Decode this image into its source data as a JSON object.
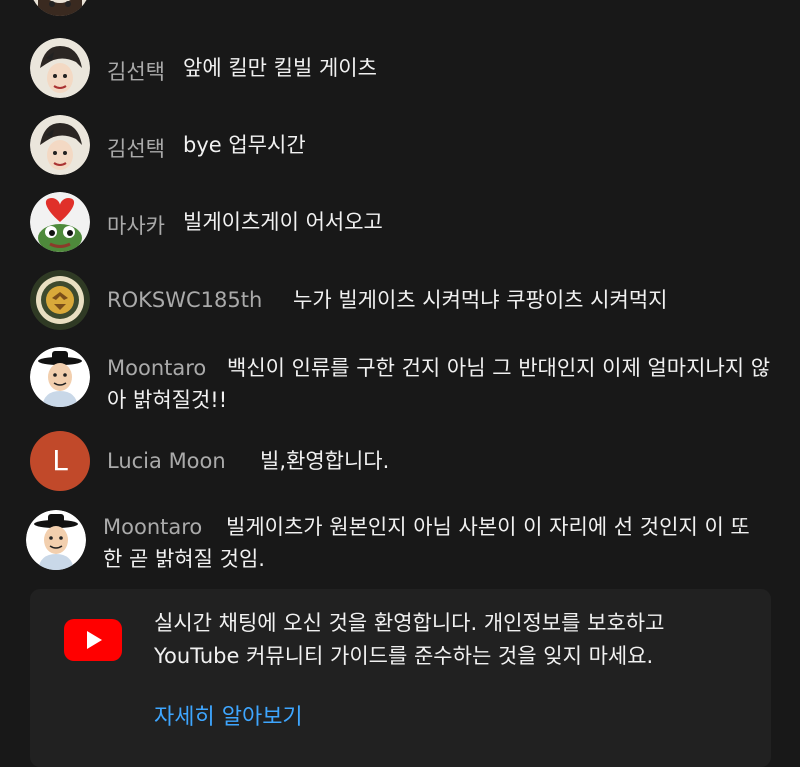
{
  "messages": [
    {
      "name": "김선택",
      "text": "앞에 킬만 킬빌 게이츠"
    },
    {
      "name": "김선택",
      "text": "bye 업무시간"
    },
    {
      "name": "마사카",
      "text": "빌게이츠게이 어서오고"
    },
    {
      "name": "ROKSWC185th",
      "text": "누가 빌게이츠 시켜먹냐 쿠팡이츠 시켜먹지"
    },
    {
      "name": "Moontaro",
      "text": "백신이 인류를 구한 건지 아님 그 반대인지 이제 얼마지나지 않아 밝혀질것!!"
    },
    {
      "name": "Lucia Moon",
      "text": "빌,환영합니다.",
      "avatar_letter": "L"
    },
    {
      "name": "Moontaro",
      "text": "빌게이츠가 원본인지 아님 사본이 이 자리에 선 것인지 이 또한 곧 밝혀질 것임."
    }
  ],
  "notice": {
    "text": "실시간 채팅에 오신 것을 환영합니다. 개인정보를 보호하고 YouTube 커뮤니티 가이드를 준수하는 것을 잊지 마세요.",
    "link": "자세히 알아보기"
  },
  "colors": {
    "background": "#181818",
    "author": "#aaaaaa",
    "link": "#3ea6ff",
    "youtube_red": "#ff0000",
    "lucia_avatar": "#c1492a"
  }
}
